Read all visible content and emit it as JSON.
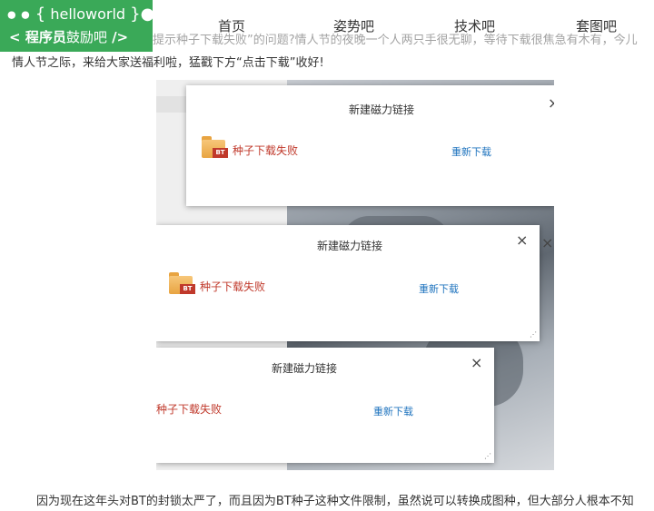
{
  "logo": {
    "line1_dots": "● ●",
    "line1_open": "{",
    "line1_word": "helloworld",
    "line1_close": "}●",
    "line2_open": "<",
    "line2_bold": "程序员",
    "line2_thin": "鼓励吧",
    "line2_close": "/>"
  },
  "nav": {
    "items": [
      "首页",
      "姿势吧",
      "技术吧",
      "套图吧"
    ]
  },
  "article": {
    "intro_line1_tail": "提示种子下载失败”的问题?情人节的夜晚一个人两只手很无聊，等待下载很焦急有木有，今儿",
    "intro_line2": "情人节之际，来给大家送福利啦，猛戳下方“点击下载”收好!",
    "bottom": "因为现在这年头对BT的封锁太严了，而且因为BT种子这种文件限制，虽然说可以转换成图种，但大部分人根本不知"
  },
  "dialogs": [
    {
      "title": "新建磁力链接",
      "file": "种子下载失败",
      "redownload": "重新下载",
      "close": "×"
    },
    {
      "title": "新建磁力链接",
      "file": "种子下载失败",
      "redownload": "重新下载",
      "close": "×"
    },
    {
      "title": "新建磁力链接",
      "file": "种子下载失败",
      "redownload": "重新下载",
      "close": "×"
    }
  ],
  "icons": {
    "folder": "folder-bt-icon",
    "close": "close-icon",
    "resize": "resize-grip-icon"
  },
  "folder_badge": "BT",
  "stray_close": "×",
  "colors": {
    "brand": "#3aa958",
    "error": "#c0392b",
    "link": "#1e73be"
  }
}
